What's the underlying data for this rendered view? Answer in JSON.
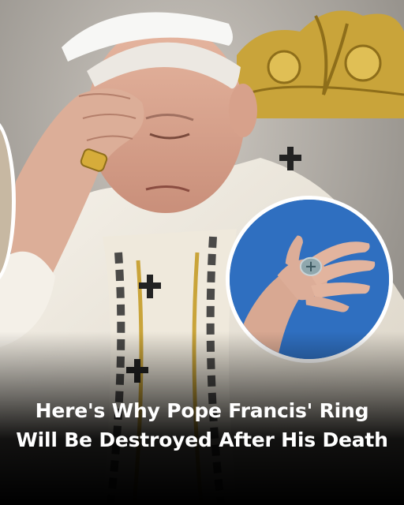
{
  "headline": {
    "line1": "Here's Why Pope Francis' Ring",
    "line2": "Will Be Destroyed After His Death"
  },
  "colors": {
    "sky_blue": "#2f6fc0",
    "gold": "#c9a43a",
    "vestment": "#f2ede2",
    "text": "#ffffff"
  }
}
